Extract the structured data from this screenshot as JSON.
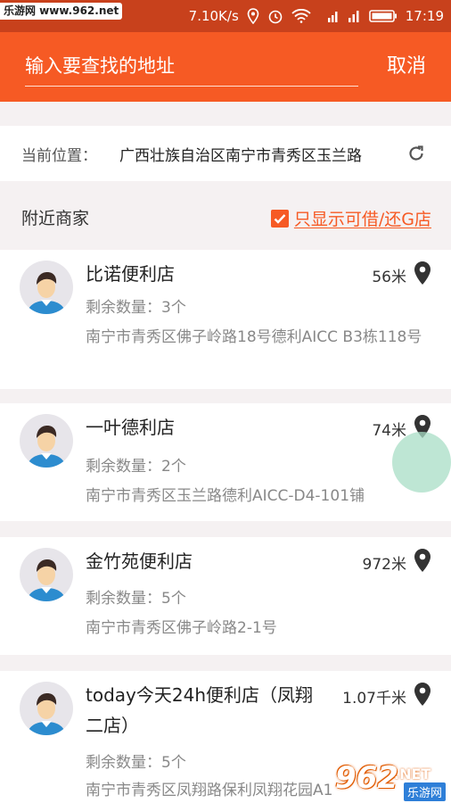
{
  "watermark_top": "乐游网 www.962.net",
  "status_bar": {
    "speed": "7.10K/s",
    "time": "17:19"
  },
  "search": {
    "placeholder": "输入要查找的地址",
    "cancel_label": "取消"
  },
  "location": {
    "label": "当前位置：",
    "value": "广西壮族自治区南宁市青秀区玉兰路"
  },
  "nearby": {
    "title": "附近商家",
    "filter_label": "只显示可借/还G店",
    "filter_checked": true
  },
  "stores": [
    {
      "name": "比诺便利店",
      "distance": "56米",
      "remaining": "剩余数量：3个",
      "address": "南宁市青秀区佛子岭路18号德利AICC B3栋118号"
    },
    {
      "name": "一叶德利店",
      "distance": "74米",
      "remaining": "剩余数量：2个",
      "address": "南宁市青秀区玉兰路德利AICC-D4-101铺"
    },
    {
      "name": "金竹苑便利店",
      "distance": "972米",
      "remaining": "剩余数量：5个",
      "address": "南宁市青秀区佛子岭路2-1号"
    },
    {
      "name": "today今天24h便利店（凤翔二店）",
      "distance": "1.07千米",
      "remaining": "剩余数量：5个",
      "address": "南宁市青秀区凤翔路保利凤翔花园A1"
    }
  ],
  "watermark_bottom": {
    "number": "962",
    "domain": ".NET",
    "site": "乐游网"
  },
  "colors": {
    "accent": "#f65a24",
    "statusbar": "#c8411c"
  }
}
